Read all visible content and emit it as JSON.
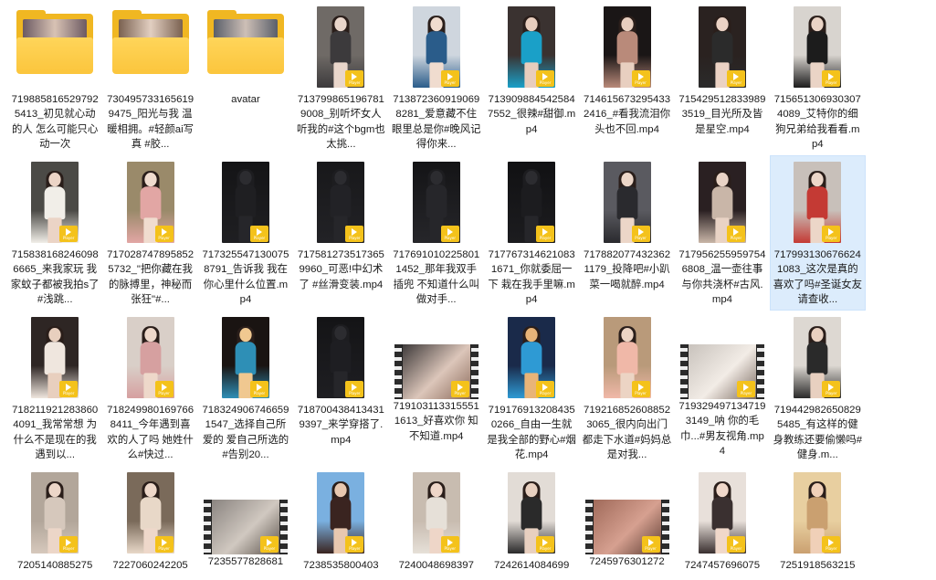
{
  "items": [
    {
      "type": "folder",
      "label": "7198858165297925413_初见就心动的人 怎么可能只心动一次",
      "colors": [
        "#6c5a62",
        "#d8c2b4"
      ]
    },
    {
      "type": "folder",
      "label": "7304957331656199475_阳光与我 温暖相拥。#轻颜ai写真 #胶...",
      "colors": [
        "#7a6150",
        "#e2cfc1"
      ]
    },
    {
      "type": "folder",
      "label": "avatar",
      "colors": [
        "#5a5f6a",
        "#cdbfb6"
      ]
    },
    {
      "type": "video",
      "label": "7137998651967819008_别听坏女人 听我的#这个bgm也太挑...",
      "colors": [
        "#6f6a66",
        "#3c3a3c",
        "#e9d6cb"
      ]
    },
    {
      "type": "video",
      "label": "7138723609190698281_爱意藏不住 眼里总是你#晚风记得你来...",
      "colors": [
        "#cfd6de",
        "#2a5c8a",
        "#f0dccf"
      ]
    },
    {
      "type": "video",
      "label": "7139098845425847552_很辣#甜御.mp4",
      "colors": [
        "#3a3230",
        "#1aa0c8",
        "#e8cdbd"
      ]
    },
    {
      "type": "video",
      "label": "7146156732954332416_#看我流泪你头也不回.mp4",
      "colors": [
        "#1a1616",
        "#b98a7a",
        "#e8cfc0"
      ]
    },
    {
      "type": "video",
      "label": "7154295128339893519_目光所及皆是星空.mp4",
      "colors": [
        "#2a2220",
        "#2b2b2b",
        "#ebd2c4"
      ]
    },
    {
      "type": "video",
      "label": "7156513069303074089_艾特你的细狗兄弟给我看看.mp4",
      "colors": [
        "#d8d4cf",
        "#1c1c1c",
        "#ead4c6"
      ]
    },
    {
      "type": "video",
      "label": "7158381682460986665_来我家玩 我家蚊子都被我拍s了#浅跳...",
      "colors": [
        "#4b4a46",
        "#f1eee8",
        "#ebd4c6"
      ]
    },
    {
      "type": "video",
      "label": "7170287478958525732_\"把你藏在我的脉搏里，神秘而张狂\"#...",
      "colors": [
        "#9a8a6a",
        "#e2a6a4",
        "#f0dccf"
      ]
    },
    {
      "type": "video",
      "label": "7173255471300758791_告诉我 我在你心里什么位置.mp4",
      "colors": [
        "#141416",
        "#1f1f22",
        "#2a2a2c"
      ],
      "dark": true
    },
    {
      "type": "video",
      "label": "7175812735173659960_可恶!中幻术了 #丝滑变装.mp4",
      "colors": [
        "#18181a",
        "#222226",
        "#3a3a3c"
      ],
      "dark": true
    },
    {
      "type": "video",
      "label": "7176910102258011452_那年我双手插兜 不知道什么叫做对手...",
      "colors": [
        "#141416",
        "#26262a",
        "#3a3a3c"
      ],
      "dark": true
    },
    {
      "type": "video",
      "label": "7177673146210831671_你就委屈一下 栽在我手里嘛.mp4",
      "colors": [
        "#111113",
        "#1c1c1f",
        "#2d2d30"
      ],
      "dark": true
    },
    {
      "type": "video",
      "label": "7178820774323621179_投降吧#小趴菜一喝就醉.mp4",
      "colors": [
        "#5a5a60",
        "#2a2a2e",
        "#ecd6c8"
      ]
    },
    {
      "type": "video",
      "label": "7179562559597546808_温一壶往事 与你共浇杯#古风.mp4",
      "colors": [
        "#2a2022",
        "#c9b6a8",
        "#e9d3c5"
      ]
    },
    {
      "type": "video",
      "label": "7179931306766241083_这次是真的喜欢了吗#圣诞女友请查收...",
      "colors": [
        "#c8c0ba",
        "#c43a34",
        "#ecd6c8"
      ],
      "selected": true
    },
    {
      "type": "video",
      "label": "7182119212838604091_我常常想 为什么不是现在的我遇到以...",
      "colors": [
        "#2e2624",
        "#efe6de",
        "#e8cfbe"
      ]
    },
    {
      "type": "video",
      "label": "7182499801697668411_今年遇到喜欢的人了吗 她姓什么#快过...",
      "colors": [
        "#d9cfc8",
        "#d6a0a0",
        "#eed8ca"
      ]
    },
    {
      "type": "video",
      "label": "7183249067466591547_选择自己所爱的 爱自己所选的#告别20...",
      "colors": [
        "#1a1412",
        "#2e8fb6",
        "#f0c890"
      ]
    },
    {
      "type": "video",
      "label": "7187004384134319397_来学穿搭了.mp4",
      "colors": [
        "#141416",
        "#1e1e22",
        "#2c2c30"
      ],
      "dark": true
    },
    {
      "type": "land",
      "label": "7191031133155511613_好喜欢你 知不知道.mp4",
      "colors": [
        "#3e3a3a",
        "#dcc6ba",
        "#8a6a5a"
      ]
    },
    {
      "type": "video",
      "label": "7191769132084350266_自由一生就是我全部的野心#烟花.mp4",
      "colors": [
        "#1a2a4a",
        "#2e9ad4",
        "#e8b478"
      ]
    },
    {
      "type": "video",
      "label": "7192168526088523065_很内向出门都走下水道#妈妈总是对我...",
      "colors": [
        "#b99a7a",
        "#f0b8a8",
        "#ecd4c4"
      ]
    },
    {
      "type": "land",
      "label": "7193294971347193149_呐 你的毛巾...#男友视角.mp4",
      "colors": [
        "#c8c2bc",
        "#f2ece6",
        "#7a6a60"
      ]
    },
    {
      "type": "video",
      "label": "7194429826508295485_有这样的健身教练还要偷懒吗#健身.m...",
      "colors": [
        "#ddd8d2",
        "#2a2a2a",
        "#e8d0c0"
      ]
    },
    {
      "type": "video",
      "label": "7205140885275",
      "colors": [
        "#b2a69a",
        "#d6c8bc",
        "#ecd6c8"
      ]
    },
    {
      "type": "video",
      "label": "7227060242205",
      "colors": [
        "#7a6a5a",
        "#e8d8c8",
        "#eed8ca"
      ]
    },
    {
      "type": "land",
      "label": "7235577828681",
      "colors": [
        "#8a8480",
        "#d0c8c0",
        "#5a504a"
      ]
    },
    {
      "type": "video",
      "label": "7238535800403",
      "colors": [
        "#7ab0e0",
        "#3a2420",
        "#e8c8b0"
      ]
    },
    {
      "type": "video",
      "label": "7240048698397",
      "colors": [
        "#c8bcb0",
        "#e6e0d8",
        "#eed6c8"
      ]
    },
    {
      "type": "video",
      "label": "7242614084699",
      "colors": [
        "#e2dcd6",
        "#2a2a2a",
        "#e8d0c0"
      ]
    },
    {
      "type": "land",
      "label": "7245976301272",
      "colors": [
        "#a06a5a",
        "#d6a090",
        "#5a3a30"
      ]
    },
    {
      "type": "video",
      "label": "7247457696075",
      "colors": [
        "#e8e0da",
        "#3a3030",
        "#f0d8ca"
      ]
    },
    {
      "type": "video",
      "label": "7251918563215",
      "colors": [
        "#e8cfa0",
        "#caa070",
        "#f0d0b8"
      ]
    }
  ],
  "badge": {
    "text": "Player",
    "color": "#f4c21b"
  },
  "selection_color": "#dcecfc"
}
